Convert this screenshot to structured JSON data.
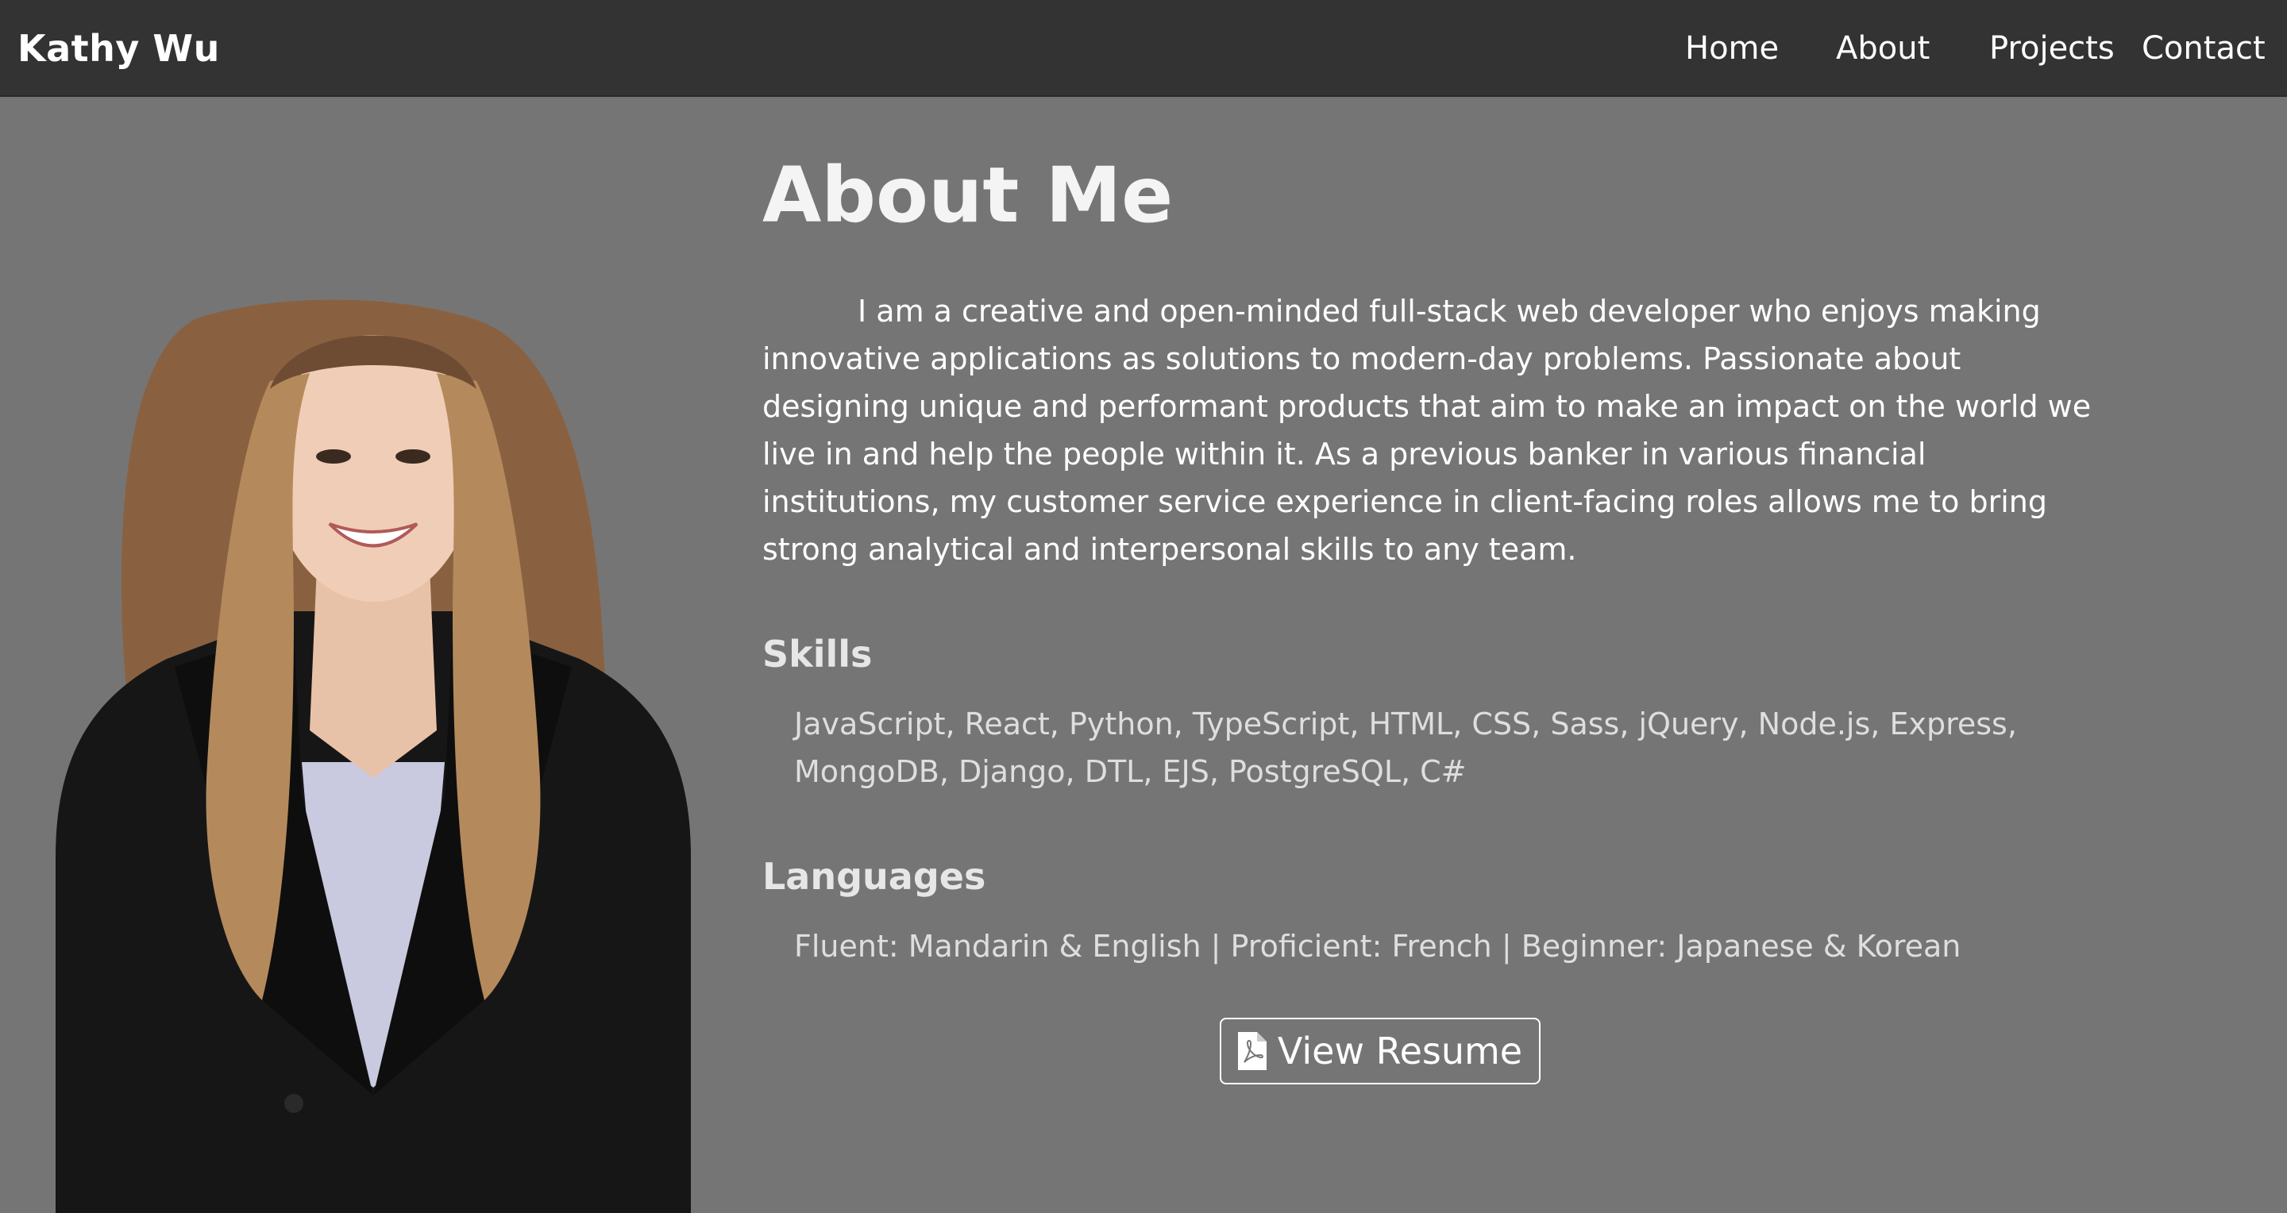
{
  "nav": {
    "brand": "Kathy Wu",
    "links": [
      "Home",
      "About",
      "Projects",
      "Contact"
    ]
  },
  "about": {
    "title": "About Me",
    "bio": "I am a creative and open-minded full-stack web developer who enjoys making innovative applications as solutions to modern-day problems. Passionate about designing unique and performant products that aim to make an impact on the world we live in and help the people within it. As a previous banker in various financial institutions, my customer service experience in client-facing roles allows me to bring strong analytical and interpersonal skills to any team.",
    "skills_heading": "Skills",
    "skills": "JavaScript, React, Python, TypeScript, HTML, CSS, Sass, jQuery, Node.js, Express, MongoDB, Django, DTL, EJS, PostgreSQL, C#",
    "languages_heading": "Languages",
    "languages": "Fluent: Mandarin & English | Proficient: French | Beginner: Japanese & Korean",
    "resume_button": "View Resume",
    "resume_icon": "file-pdf-icon"
  },
  "colors": {
    "background": "#757575",
    "navbar": "#333333",
    "text": "#ffffff"
  }
}
